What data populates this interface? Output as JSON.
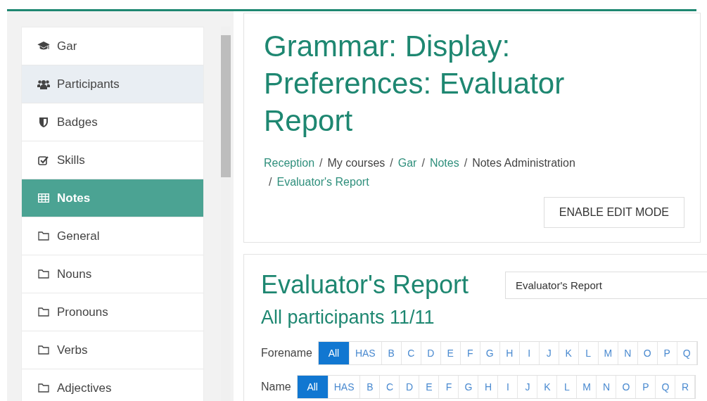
{
  "sidebar": {
    "items": [
      {
        "label": "Gar",
        "kind": "cap",
        "selected": false,
        "hovered": false
      },
      {
        "label": "Participants",
        "kind": "users",
        "selected": false,
        "hovered": true
      },
      {
        "label": "Badges",
        "kind": "shield",
        "selected": false,
        "hovered": false
      },
      {
        "label": "Skills",
        "kind": "check",
        "selected": false,
        "hovered": false
      },
      {
        "label": "Notes",
        "kind": "table",
        "selected": true,
        "hovered": false
      },
      {
        "label": "General",
        "kind": "folder",
        "selected": false,
        "hovered": false
      },
      {
        "label": "Nouns",
        "kind": "folder",
        "selected": false,
        "hovered": false
      },
      {
        "label": "Pronouns",
        "kind": "folder",
        "selected": false,
        "hovered": false
      },
      {
        "label": "Verbs",
        "kind": "folder",
        "selected": false,
        "hovered": false
      },
      {
        "label": "Adjectives",
        "kind": "folder",
        "selected": false,
        "hovered": false
      }
    ]
  },
  "header": {
    "title": "Grammar: Display: Preferences: Evaluator Report",
    "breadcrumb": [
      {
        "label": "Reception",
        "kind": "link"
      },
      {
        "separator": "/",
        "label": "My courses",
        "kind": "text"
      },
      {
        "separator": "/",
        "label": "Gar",
        "kind": "link"
      },
      {
        "separator": "/",
        "label": "Notes",
        "kind": "link"
      },
      {
        "separator": "/",
        "label": "Notes Administration",
        "kind": "text"
      },
      {
        "separator": "/",
        "label": "Evaluator's Report",
        "kind": "link"
      }
    ],
    "button": "ENABLE EDIT MODE"
  },
  "report": {
    "title": "Evaluator's Report",
    "select": "Evaluator's Report",
    "subtitle": "All participants 11/11",
    "filters": [
      {
        "label": "Forename",
        "letters": [
          {
            "label": "All",
            "selected": true
          },
          {
            "label": "HAS",
            "selected": false
          },
          {
            "label": "B",
            "selected": false
          },
          {
            "label": "C",
            "selected": false
          },
          {
            "label": "D",
            "selected": false
          },
          {
            "label": "E",
            "selected": false
          },
          {
            "label": "F",
            "selected": false
          },
          {
            "label": "G",
            "selected": false
          },
          {
            "label": "H",
            "selected": false
          },
          {
            "label": "I",
            "selected": false
          },
          {
            "label": "J",
            "selected": false
          },
          {
            "label": "K",
            "selected": false
          },
          {
            "label": "L",
            "selected": false
          },
          {
            "label": "M",
            "selected": false
          },
          {
            "label": "N",
            "selected": false
          },
          {
            "label": "O",
            "selected": false
          },
          {
            "label": "P",
            "selected": false
          },
          {
            "label": "Q",
            "selected": false
          }
        ]
      },
      {
        "label": "Name",
        "letters": [
          {
            "label": "All",
            "selected": true
          },
          {
            "label": "HAS",
            "selected": false
          },
          {
            "label": "B",
            "selected": false
          },
          {
            "label": "C",
            "selected": false
          },
          {
            "label": "D",
            "selected": false
          },
          {
            "label": "E",
            "selected": false
          },
          {
            "label": "F",
            "selected": false
          },
          {
            "label": "G",
            "selected": false
          },
          {
            "label": "H",
            "selected": false
          },
          {
            "label": "I",
            "selected": false
          },
          {
            "label": "J",
            "selected": false
          },
          {
            "label": "K",
            "selected": false
          },
          {
            "label": "L",
            "selected": false
          },
          {
            "label": "M",
            "selected": false
          },
          {
            "label": "N",
            "selected": false
          },
          {
            "label": "O",
            "selected": false
          },
          {
            "label": "P",
            "selected": false
          },
          {
            "label": "Q",
            "selected": false
          },
          {
            "label": "R",
            "selected": false
          }
        ]
      }
    ]
  }
}
